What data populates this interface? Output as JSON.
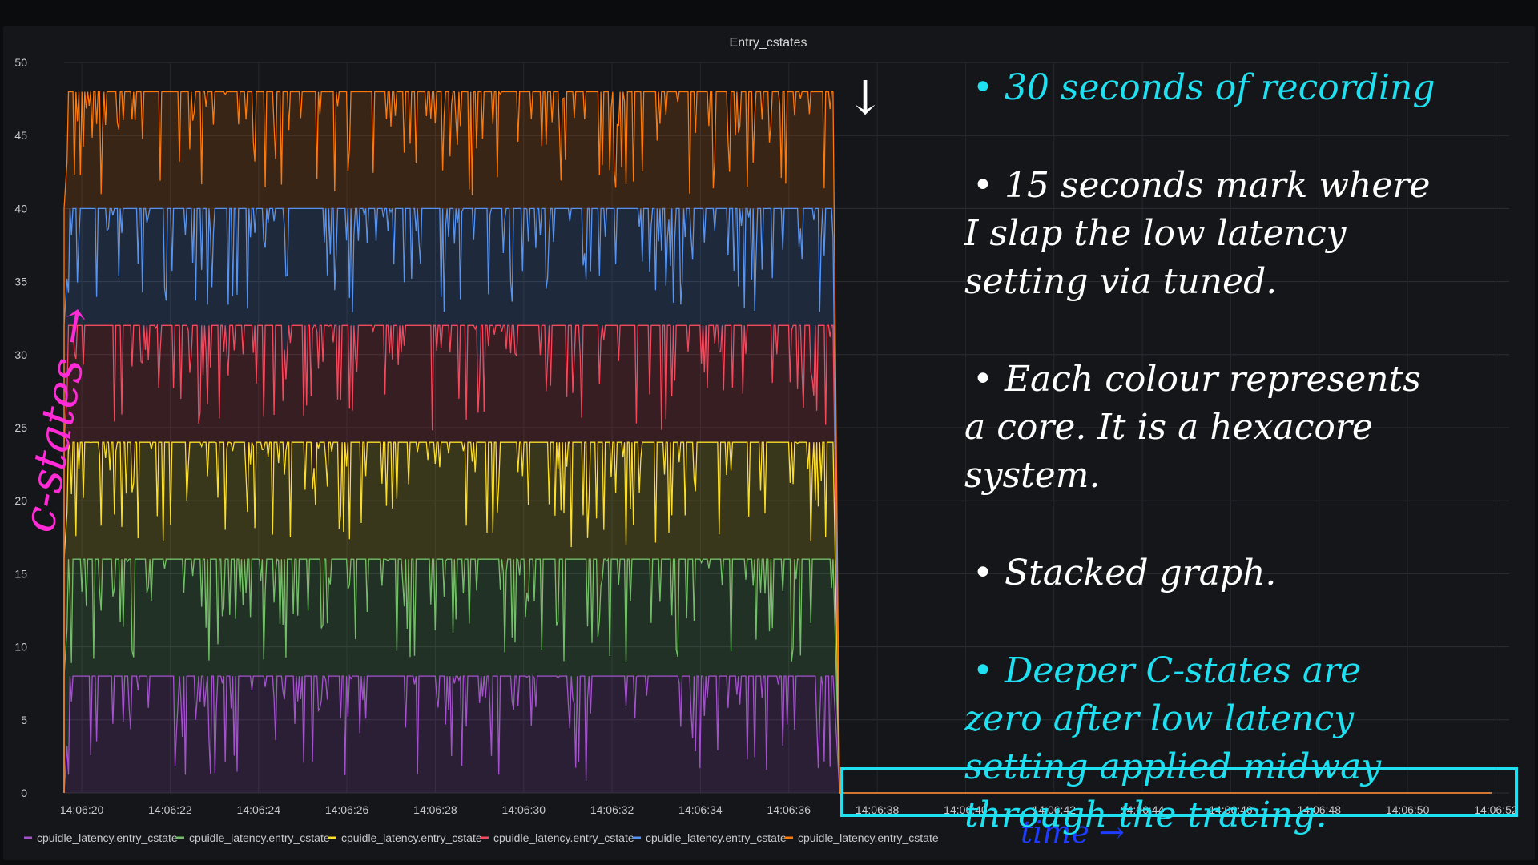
{
  "panel": {
    "title": "Entry_cstates"
  },
  "chart_data": {
    "type": "area",
    "stacked": true,
    "title": "Entry_cstates",
    "xlabel": "",
    "ylabel": "",
    "ylim": [
      0,
      50
    ],
    "yticks": [
      0,
      5,
      10,
      15,
      20,
      25,
      30,
      35,
      40,
      45,
      50
    ],
    "xticks": [
      "14:06:20",
      "14:06:22",
      "14:06:24",
      "14:06:26",
      "14:06:28",
      "14:06:30",
      "14:06:32",
      "14:06:34",
      "14:06:36",
      "14:06:38",
      "14:06:40",
      "14:06:42",
      "14:06:44",
      "14:06:46",
      "14:06:48",
      "14:06:50",
      "14:06:52"
    ],
    "x_start": "14:06:19.6",
    "x_end": "14:06:52.3",
    "low_latency_applied_at": "14:06:37.0",
    "grid": true,
    "legend_placement": "bottom-left",
    "series": [
      {
        "name": "cpuidle_latency.entry_cstate",
        "color": "#a352cc",
        "per_core_max": 8,
        "stacked_top_before": 8,
        "stacked_top_after": 0
      },
      {
        "name": "cpuidle_latency.entry_cstate",
        "color": "#73bf69",
        "per_core_max": 8,
        "stacked_top_before": 16,
        "stacked_top_after": 0
      },
      {
        "name": "cpuidle_latency.entry_cstate",
        "color": "#fade2a",
        "per_core_max": 8,
        "stacked_top_before": 24,
        "stacked_top_after": 0
      },
      {
        "name": "cpuidle_latency.entry_cstate",
        "color": "#f2495c",
        "per_core_max": 8,
        "stacked_top_before": 32,
        "stacked_top_after": 0
      },
      {
        "name": "cpuidle_latency.entry_cstate",
        "color": "#5794f2",
        "per_core_max": 8,
        "stacked_top_before": 40,
        "stacked_top_after": 0
      },
      {
        "name": "cpuidle_latency.entry_cstate",
        "color": "#ff780a",
        "per_core_max": 8,
        "stacked_top_before": 48,
        "stacked_top_after": 0
      }
    ]
  },
  "annotations": {
    "axis_y": "c-states →",
    "axis_x": "time →",
    "arrow": "↓",
    "notes": [
      {
        "lines": [
          "• 30 seconds of recording"
        ],
        "color": "#1ee0f0"
      },
      {
        "lines": [
          "• 15 seconds mark where",
          "I slap the low latency",
          "setting via tuned."
        ],
        "color": "#ffffff"
      },
      {
        "lines": [
          "• Each colour represents",
          "a core. It is a hexacore",
          "system."
        ],
        "color": "#ffffff"
      },
      {
        "lines": [
          "• Stacked graph."
        ],
        "color": "#ffffff"
      },
      {
        "lines": [
          "• Deeper C-states are",
          "zero after low latency",
          "setting applied midway",
          "through the tracing."
        ],
        "color": "#1ee0f0"
      }
    ],
    "colors": {
      "axis_y": "#ff2bd6",
      "axis_x": "#1d3cff",
      "highlight_box": "#1ee0f0",
      "arrow": "#ffffff"
    }
  }
}
